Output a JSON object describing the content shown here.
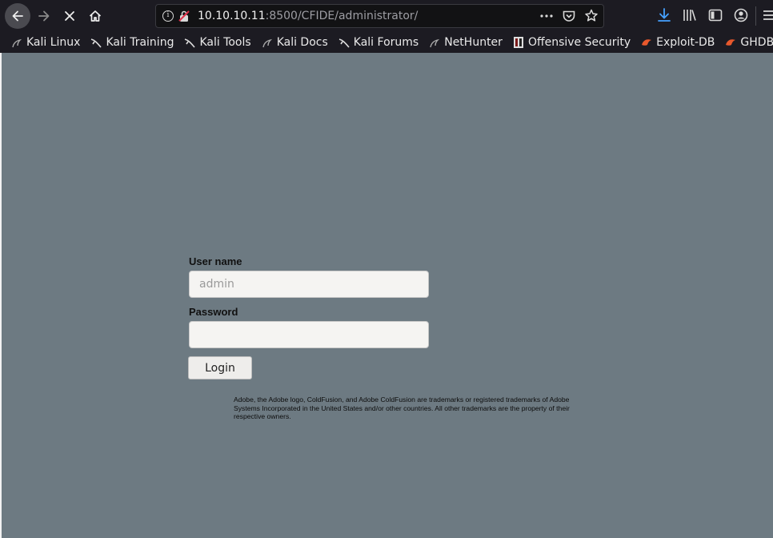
{
  "browser": {
    "url": {
      "host": "10.10.10.11",
      "rest": ":8500/CFIDE/administrator/"
    },
    "icons": {
      "back": "arrow-left-icon",
      "forward": "arrow-right-icon",
      "stop": "close-icon",
      "home": "home-icon",
      "info": "info-icon",
      "lock": "insecure-lock-icon",
      "page_actions": "more-icon",
      "pocket": "pocket-icon",
      "bookmark_star": "star-icon",
      "downloads": "download-icon",
      "library": "library-icon",
      "sidebar": "sidebar-icon",
      "account": "account-icon",
      "menu": "hamburger-icon"
    },
    "bookmarks": [
      {
        "label": "Kali Linux",
        "icon": "kali-dragon-icon"
      },
      {
        "label": "Kali Training",
        "icon": "kali-dragon-icon"
      },
      {
        "label": "Kali Tools",
        "icon": "kali-dragon-icon"
      },
      {
        "label": "Kali Docs",
        "icon": "kali-dragon-icon"
      },
      {
        "label": "Kali Forums",
        "icon": "kali-dragon-icon"
      },
      {
        "label": "NetHunter",
        "icon": "kali-dragon-icon"
      },
      {
        "label": "Offensive Security",
        "icon": "offsec-icon"
      },
      {
        "label": "Exploit-DB",
        "icon": "exploitdb-icon"
      },
      {
        "label": "GHDB",
        "icon": "exploitdb-icon"
      }
    ],
    "accent_download": "#45a1ff"
  },
  "login": {
    "username_label": "User name",
    "username_placeholder": "admin",
    "password_label": "Password",
    "password_value": "",
    "submit_label": "Login"
  },
  "footer": {
    "trademark": "Adobe, the Adobe logo, ColdFusion, and Adobe ColdFusion are trademarks or registered trademarks of Adobe Systems Incorporated in the United States and/or other countries. All other trademarks are the property of their respective owners."
  },
  "colors": {
    "page_bg": "#6d7a82",
    "chrome_bg": "#1c1b22"
  }
}
